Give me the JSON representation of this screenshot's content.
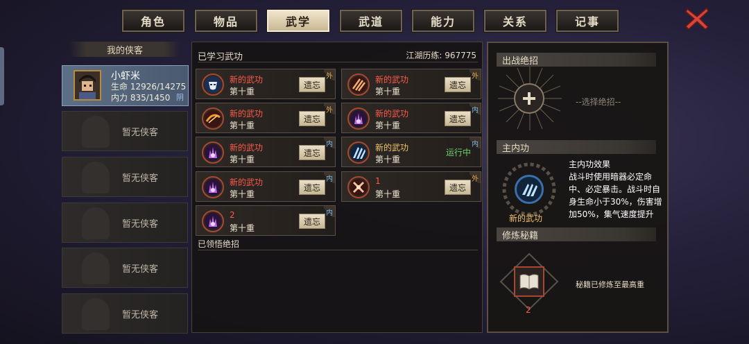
{
  "tabs": [
    {
      "label": "角色",
      "active": false
    },
    {
      "label": "物品",
      "active": false
    },
    {
      "label": "武学",
      "active": true
    },
    {
      "label": "武道",
      "active": false
    },
    {
      "label": "能力",
      "active": false
    },
    {
      "label": "关系",
      "active": false
    },
    {
      "label": "记事",
      "active": false
    }
  ],
  "close_icon": "close-x-icon",
  "party": {
    "header": "我的侠客",
    "hero": {
      "name": "小虾米",
      "hp_label": "生命",
      "hp_value": "12926/14275",
      "mp_label": "内力",
      "mp_value": "835/1450",
      "tag": "阴"
    },
    "empty_label": "暂无侠客",
    "empty_slots": 5
  },
  "learned": {
    "title": "已学习武功",
    "exp_label": "江湖历练:",
    "exp_value": "967775",
    "forget_label": "遗忘",
    "running_label": "运行中",
    "skills": [
      {
        "name": "新的武功",
        "level": "第十重",
        "tag": "外",
        "status": "forget",
        "color": "red",
        "icon": "mask-icon"
      },
      {
        "name": "新的武功",
        "level": "第十重",
        "tag": "外",
        "status": "forget",
        "color": "red",
        "icon": "claw-icon"
      },
      {
        "name": "新的武功",
        "level": "第十重",
        "tag": "外",
        "status": "forget",
        "color": "red",
        "icon": "sword-slash-icon"
      },
      {
        "name": "新的武功",
        "level": "第十重",
        "tag": "内",
        "status": "forget",
        "color": "red",
        "icon": "purple-flame-icon"
      },
      {
        "name": "新的武功",
        "level": "第十重",
        "tag": "内",
        "status": "forget",
        "color": "red",
        "icon": "purple-flame-icon"
      },
      {
        "name": "新的武功",
        "level": "第十重",
        "tag": "内",
        "status": "running",
        "color": "gold",
        "icon": "blue-claw-icon"
      },
      {
        "name": "新的武功",
        "level": "第十重",
        "tag": "内",
        "status": "forget",
        "color": "red",
        "icon": "purple-flame-icon"
      },
      {
        "name": "1",
        "level": "第十重",
        "tag": "外",
        "status": "forget",
        "color": "red",
        "icon": "cross-blade-icon"
      },
      {
        "name": "2",
        "level": "第十重",
        "tag": "内",
        "status": "forget",
        "color": "red",
        "icon": "purple-flame-icon"
      }
    ],
    "comprehended_title": "已领悟绝招"
  },
  "right": {
    "battle_title": "出战绝招",
    "battle_hint": "--选择绝招--",
    "inner_title": "主内功",
    "inner_name": "新的武功",
    "inner_effect_title": "主内功效果",
    "inner_effect_text": "战斗时使用暗器必定命中、必定暴击。战斗时自身生命小于30%，伤害增加50%，集气速度提升",
    "manual_title": "修炼秘籍",
    "manual_count": "2",
    "manual_status": "秘籍已修炼至最高重"
  },
  "colors": {
    "red_name": "#ff5a4a",
    "gold_name": "#f1c46a",
    "running": "#6ed36a",
    "tag_wai": "#d9a350",
    "tag_nei": "#6fb6e8"
  }
}
